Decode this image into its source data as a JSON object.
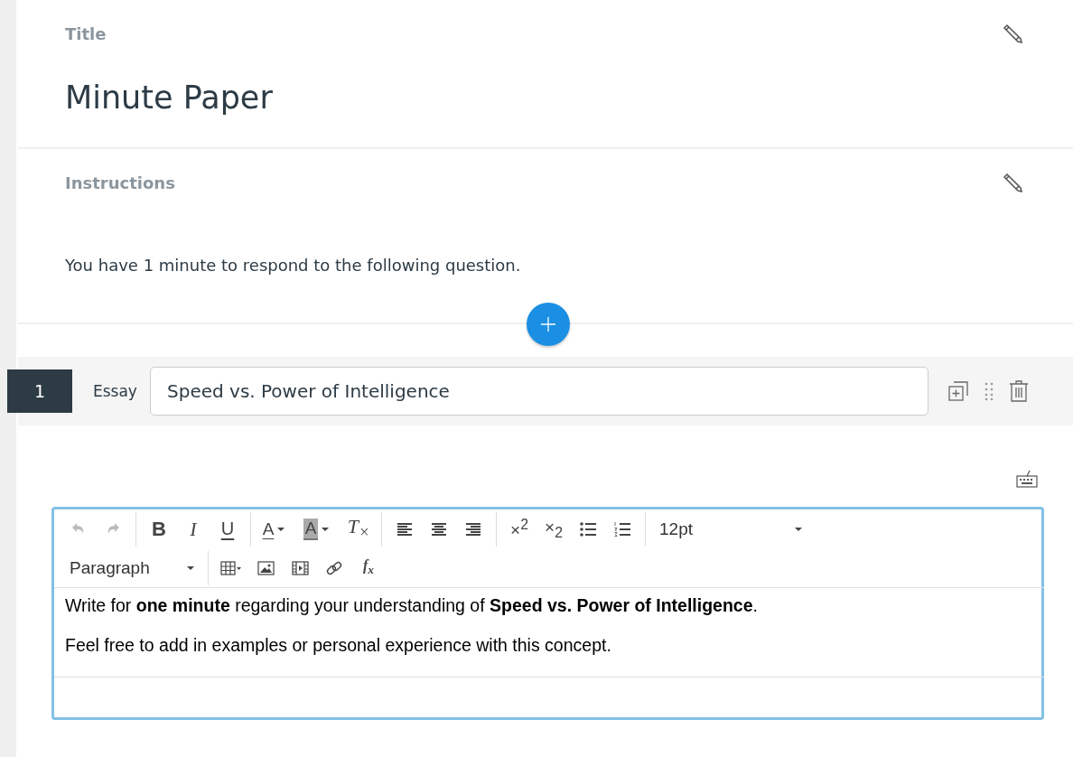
{
  "title_section": {
    "label": "Title",
    "value": "Minute Paper"
  },
  "instructions_section": {
    "label": "Instructions",
    "text": "You have 1 minute to respond to the following question."
  },
  "question": {
    "number": "1",
    "type": "Essay",
    "title": "Speed vs. Power of Intelligence"
  },
  "editor": {
    "toolbar_rows": [
      [
        [
          {
            "kind": "undo",
            "disabled": true
          },
          {
            "kind": "redo",
            "disabled": true
          }
        ],
        [
          {
            "kind": "bold",
            "label": "B"
          },
          {
            "kind": "italic",
            "label": "I"
          },
          {
            "kind": "underline",
            "label": "U"
          }
        ],
        [
          {
            "kind": "text-color",
            "label": "A"
          },
          {
            "kind": "background-color",
            "label": "A"
          },
          {
            "kind": "clear-format",
            "label": "T$_{×}$"
          }
        ],
        [
          {
            "kind": "align-left"
          },
          {
            "kind": "align-center"
          },
          {
            "kind": "align-right"
          }
        ],
        [
          {
            "kind": "superscript",
            "label": "×$^{2}$"
          },
          {
            "kind": "subscript",
            "label": "×$_{2}$"
          },
          {
            "kind": "bullet-list"
          },
          {
            "kind": "numbered-list"
          }
        ],
        [
          {
            "kind": "dropdown",
            "label": "12pt"
          }
        ]
      ],
      [
        [
          {
            "kind": "dropdown",
            "label": "Paragraph"
          }
        ],
        [
          {
            "kind": "table"
          },
          {
            "kind": "image"
          },
          {
            "kind": "media"
          },
          {
            "kind": "link"
          },
          {
            "kind": "formula",
            "label": "f$_{x}$"
          }
        ]
      ]
    ],
    "paragraphs": [
      "Write for **one minute** regarding your understanding of **Speed vs. Power of Intelligence**.",
      "Feel free to add in examples or personal experience with this concept."
    ]
  }
}
